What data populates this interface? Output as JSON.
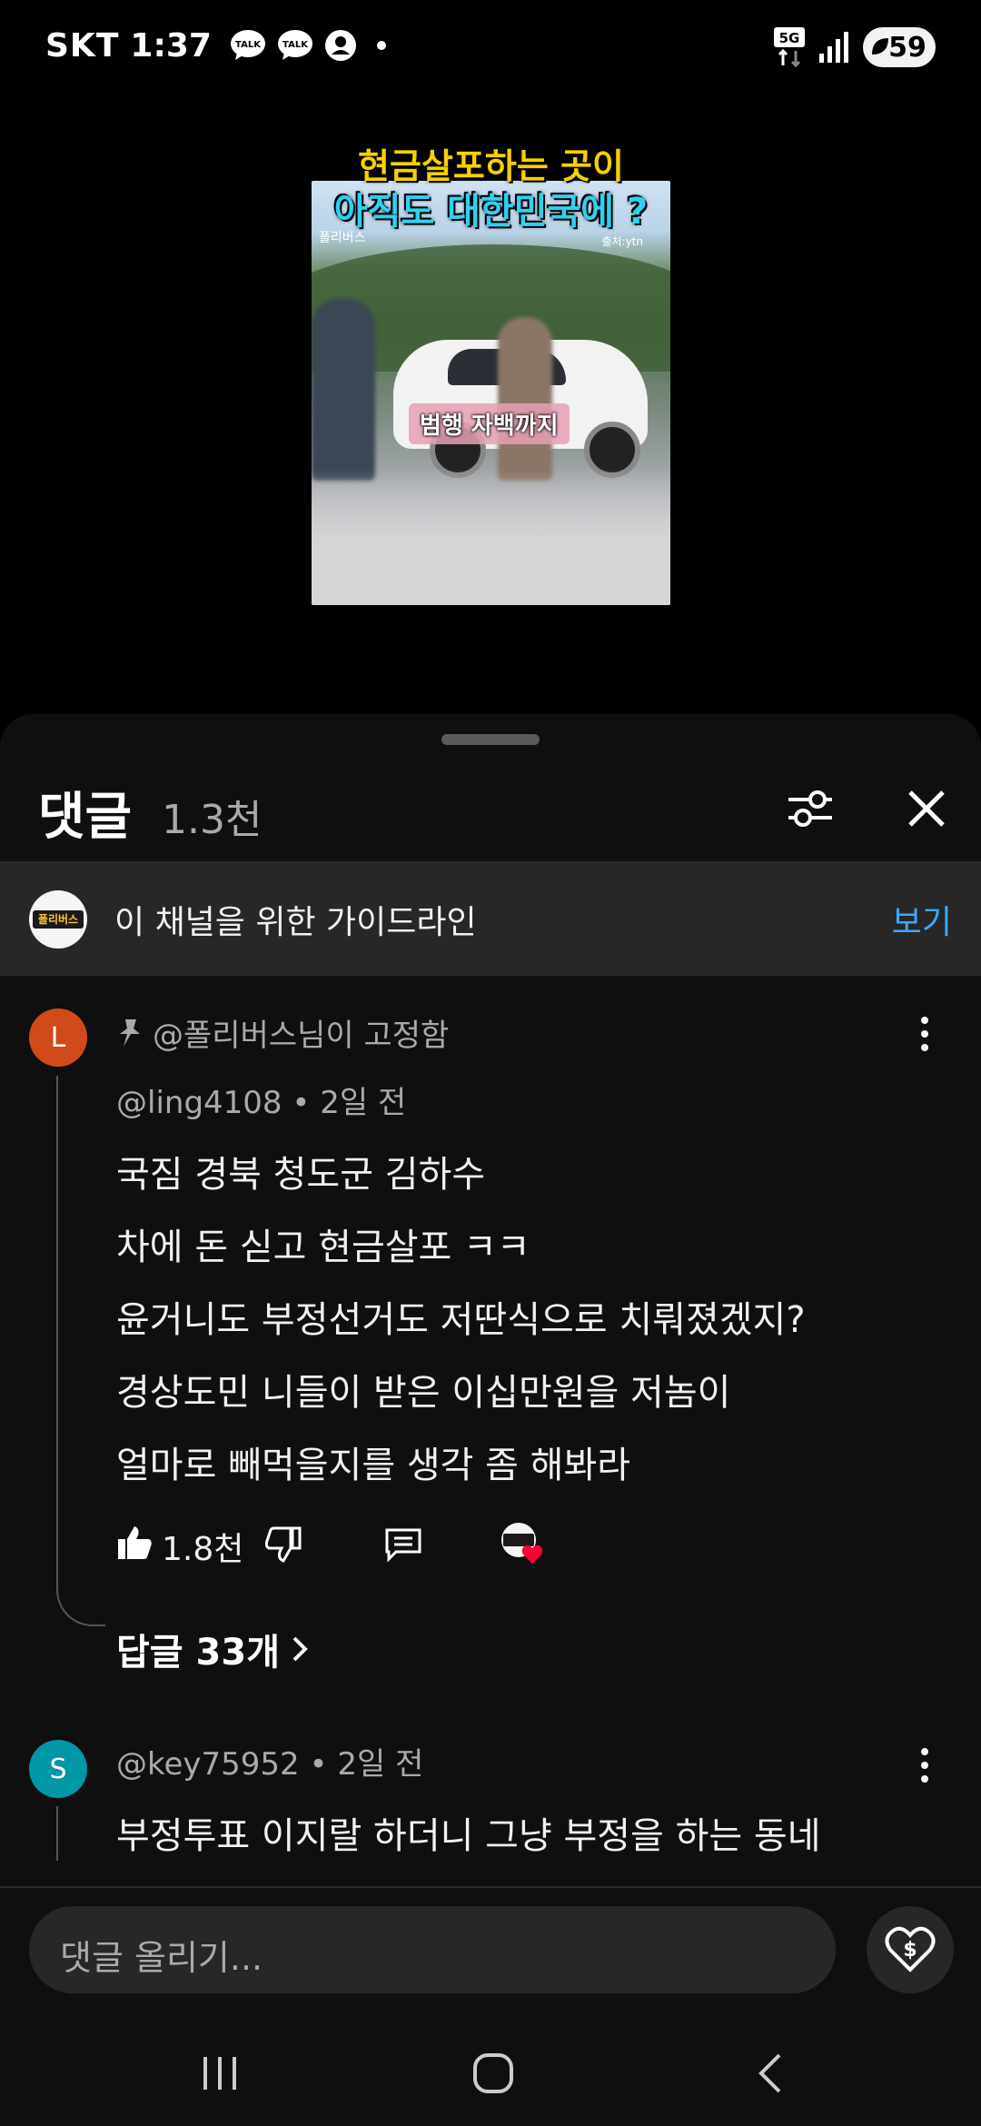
{
  "status_bar": {
    "carrier": "SKT",
    "time": "1:37",
    "notification_icons": [
      "talk-icon",
      "talk-icon",
      "account-icon",
      "dot"
    ],
    "network": "5G",
    "battery": "59"
  },
  "video": {
    "title_line1": "현금살포하는 곳이",
    "title_line2": "아직도 대한민국에 ?",
    "caption": "범행 자백까지",
    "watermark_left": "폴리버스",
    "watermark_right": "출처:ytn"
  },
  "comments_panel": {
    "title": "댓글",
    "count": "1.3천",
    "guideline_text": "이 채널을 위한 가이드라인",
    "guideline_link": "보기",
    "guideline_avatar_text": "폴리버스"
  },
  "comments": [
    {
      "avatar_letter": "L",
      "avatar_color": "#d14a1a",
      "pinned_text": "@폴리버스님이 고정함",
      "meta": "@ling4108 • 2일 전",
      "lines": [
        "국짐 경북 청도군 김하수",
        "차에 돈 싣고 현금살포 ㅋㅋ",
        "윤거니도 부정선거도 저딴식으로 치뤄졌겠지?",
        "경상도민 니들이 받은 이십만원을 저놈이",
        "얼마로 빼먹을지를 생각 좀 해봐라"
      ],
      "likes": "1.8천",
      "replies": "답글 33개"
    },
    {
      "avatar_letter": "S",
      "avatar_color": "#0097a7",
      "meta": "@key75952 • 2일 전",
      "lines": [
        "부정투표 이지랄 하더니 그냥 부정을 하는 동네"
      ]
    }
  ],
  "input": {
    "placeholder": "댓글 올리기..."
  },
  "colors": {
    "accent_link": "#3ea6ff",
    "sheet_bg": "#0f0f0f",
    "guide_bg": "#272727",
    "heart": "#ff0033"
  }
}
